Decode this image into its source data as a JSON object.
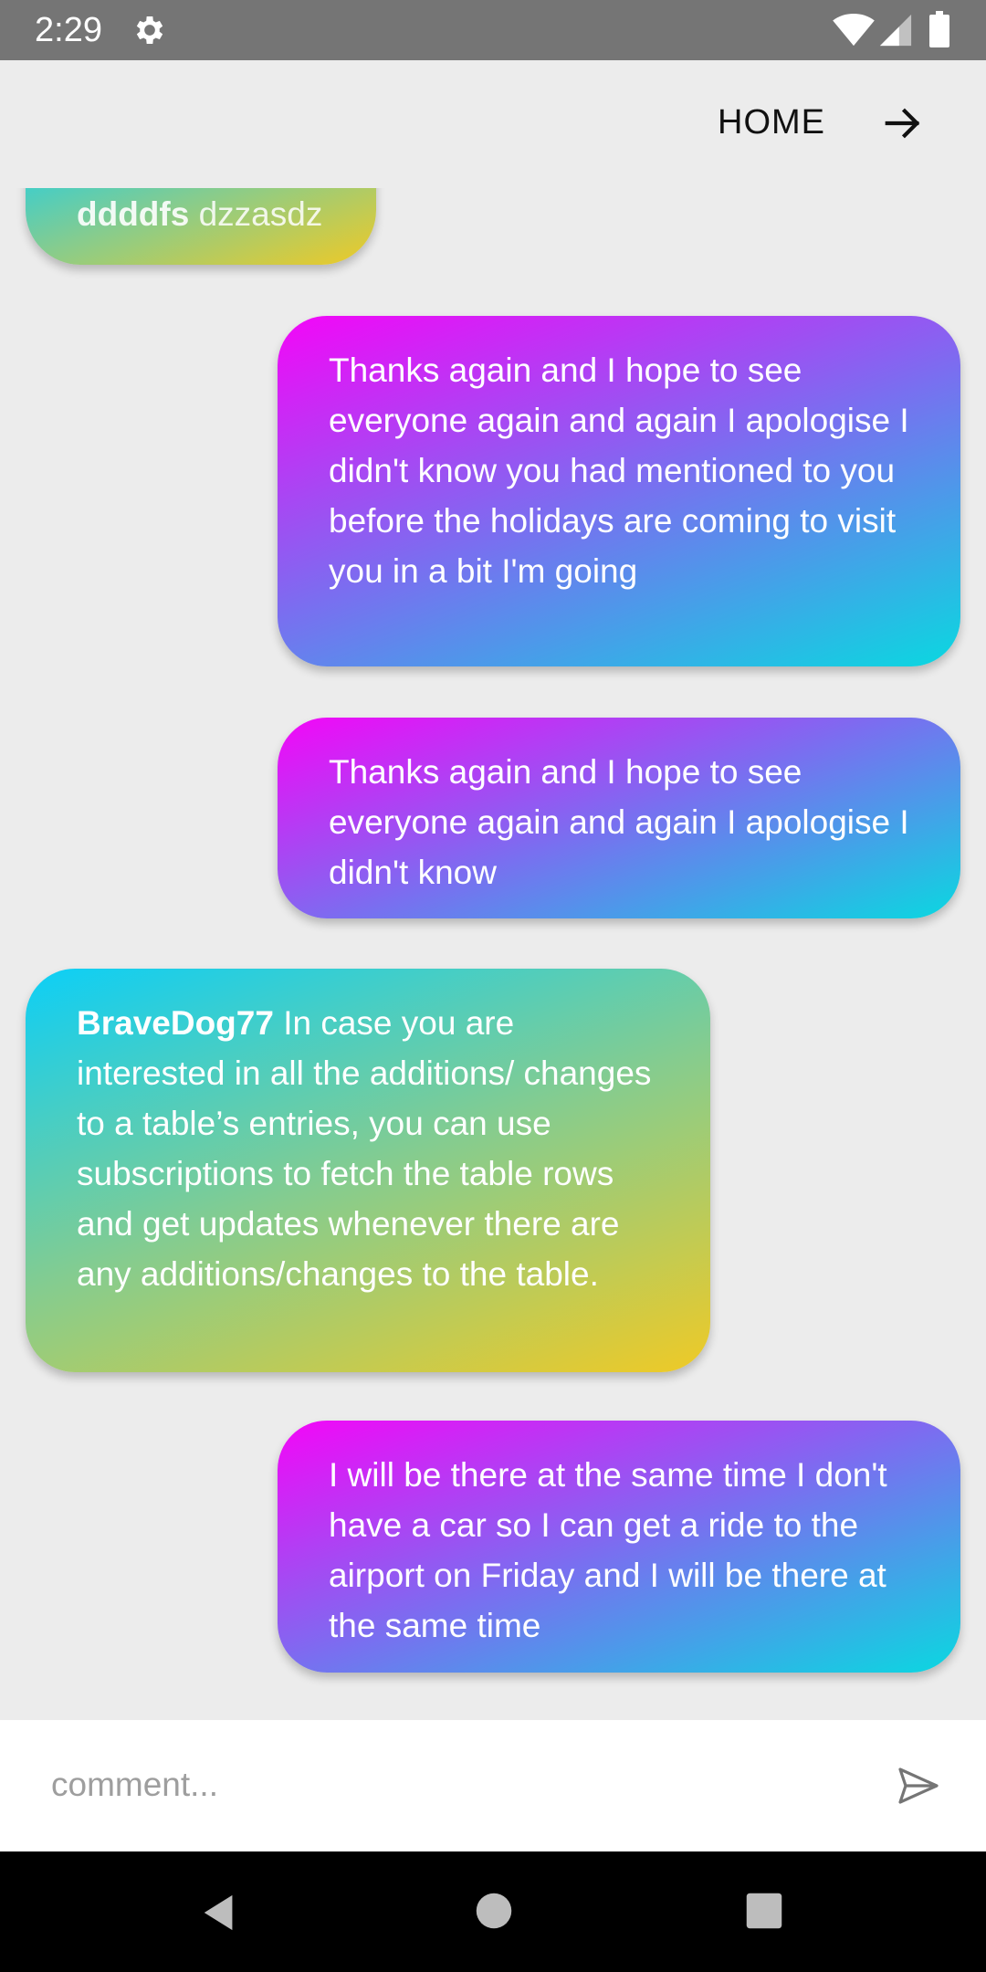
{
  "status_bar": {
    "time": "2:29"
  },
  "header": {
    "home_label": "HOME"
  },
  "messages": [
    {
      "author": "ddddfs",
      "text": "dzzasdz",
      "side": "left"
    },
    {
      "author": "",
      "text": "Thanks again and I hope to see everyone again and again I apologise I didn't know you had mentioned to you before the holidays are coming to visit you in a bit I'm going",
      "side": "right"
    },
    {
      "author": "",
      "text": "Thanks again and I hope to see everyone again and again I apologise I didn't know",
      "side": "right"
    },
    {
      "author": "BraveDog77",
      "text": "In case you are interested in all the additions/ changes to a table’s entries, you can use subscriptions to fetch the table rows and get updates whenever there are any additions/changes to the table.",
      "side": "left"
    },
    {
      "author": "",
      "text": "I will be there at the same time I don't have a car so I can get a ride to the airport on Friday and I will be there at the same time",
      "side": "right"
    }
  ],
  "comment": {
    "placeholder": "comment...",
    "value": ""
  },
  "colors": {
    "mine_gradient": [
      "#f406f8",
      "#7a6ef0",
      "#0ad8e0"
    ],
    "theirs_gradient": [
      "#0ccff7",
      "#85cc8f",
      "#efca26"
    ],
    "status_bar": "#757575",
    "background": "#ececec"
  },
  "icons": {
    "status": [
      "gear-icon",
      "wifi-icon",
      "signal-icon",
      "battery-icon"
    ],
    "header": "arrow-right-icon",
    "send": "send-icon",
    "nav": [
      "back-icon",
      "home-icon",
      "recents-icon"
    ]
  }
}
